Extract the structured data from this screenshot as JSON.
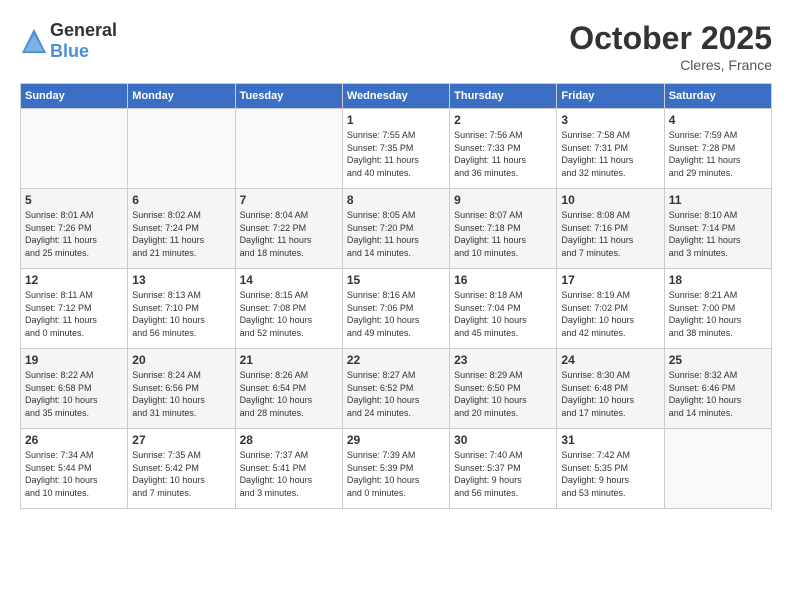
{
  "header": {
    "logo_general": "General",
    "logo_blue": "Blue",
    "month": "October 2025",
    "location": "Cleres, France"
  },
  "weekdays": [
    "Sunday",
    "Monday",
    "Tuesday",
    "Wednesday",
    "Thursday",
    "Friday",
    "Saturday"
  ],
  "weeks": [
    [
      {
        "day": "",
        "info": ""
      },
      {
        "day": "",
        "info": ""
      },
      {
        "day": "",
        "info": ""
      },
      {
        "day": "1",
        "info": "Sunrise: 7:55 AM\nSunset: 7:35 PM\nDaylight: 11 hours\nand 40 minutes."
      },
      {
        "day": "2",
        "info": "Sunrise: 7:56 AM\nSunset: 7:33 PM\nDaylight: 11 hours\nand 36 minutes."
      },
      {
        "day": "3",
        "info": "Sunrise: 7:58 AM\nSunset: 7:31 PM\nDaylight: 11 hours\nand 32 minutes."
      },
      {
        "day": "4",
        "info": "Sunrise: 7:59 AM\nSunset: 7:28 PM\nDaylight: 11 hours\nand 29 minutes."
      }
    ],
    [
      {
        "day": "5",
        "info": "Sunrise: 8:01 AM\nSunset: 7:26 PM\nDaylight: 11 hours\nand 25 minutes."
      },
      {
        "day": "6",
        "info": "Sunrise: 8:02 AM\nSunset: 7:24 PM\nDaylight: 11 hours\nand 21 minutes."
      },
      {
        "day": "7",
        "info": "Sunrise: 8:04 AM\nSunset: 7:22 PM\nDaylight: 11 hours\nand 18 minutes."
      },
      {
        "day": "8",
        "info": "Sunrise: 8:05 AM\nSunset: 7:20 PM\nDaylight: 11 hours\nand 14 minutes."
      },
      {
        "day": "9",
        "info": "Sunrise: 8:07 AM\nSunset: 7:18 PM\nDaylight: 11 hours\nand 10 minutes."
      },
      {
        "day": "10",
        "info": "Sunrise: 8:08 AM\nSunset: 7:16 PM\nDaylight: 11 hours\nand 7 minutes."
      },
      {
        "day": "11",
        "info": "Sunrise: 8:10 AM\nSunset: 7:14 PM\nDaylight: 11 hours\nand 3 minutes."
      }
    ],
    [
      {
        "day": "12",
        "info": "Sunrise: 8:11 AM\nSunset: 7:12 PM\nDaylight: 11 hours\nand 0 minutes."
      },
      {
        "day": "13",
        "info": "Sunrise: 8:13 AM\nSunset: 7:10 PM\nDaylight: 10 hours\nand 56 minutes."
      },
      {
        "day": "14",
        "info": "Sunrise: 8:15 AM\nSunset: 7:08 PM\nDaylight: 10 hours\nand 52 minutes."
      },
      {
        "day": "15",
        "info": "Sunrise: 8:16 AM\nSunset: 7:06 PM\nDaylight: 10 hours\nand 49 minutes."
      },
      {
        "day": "16",
        "info": "Sunrise: 8:18 AM\nSunset: 7:04 PM\nDaylight: 10 hours\nand 45 minutes."
      },
      {
        "day": "17",
        "info": "Sunrise: 8:19 AM\nSunset: 7:02 PM\nDaylight: 10 hours\nand 42 minutes."
      },
      {
        "day": "18",
        "info": "Sunrise: 8:21 AM\nSunset: 7:00 PM\nDaylight: 10 hours\nand 38 minutes."
      }
    ],
    [
      {
        "day": "19",
        "info": "Sunrise: 8:22 AM\nSunset: 6:58 PM\nDaylight: 10 hours\nand 35 minutes."
      },
      {
        "day": "20",
        "info": "Sunrise: 8:24 AM\nSunset: 6:56 PM\nDaylight: 10 hours\nand 31 minutes."
      },
      {
        "day": "21",
        "info": "Sunrise: 8:26 AM\nSunset: 6:54 PM\nDaylight: 10 hours\nand 28 minutes."
      },
      {
        "day": "22",
        "info": "Sunrise: 8:27 AM\nSunset: 6:52 PM\nDaylight: 10 hours\nand 24 minutes."
      },
      {
        "day": "23",
        "info": "Sunrise: 8:29 AM\nSunset: 6:50 PM\nDaylight: 10 hours\nand 20 minutes."
      },
      {
        "day": "24",
        "info": "Sunrise: 8:30 AM\nSunset: 6:48 PM\nDaylight: 10 hours\nand 17 minutes."
      },
      {
        "day": "25",
        "info": "Sunrise: 8:32 AM\nSunset: 6:46 PM\nDaylight: 10 hours\nand 14 minutes."
      }
    ],
    [
      {
        "day": "26",
        "info": "Sunrise: 7:34 AM\nSunset: 5:44 PM\nDaylight: 10 hours\nand 10 minutes."
      },
      {
        "day": "27",
        "info": "Sunrise: 7:35 AM\nSunset: 5:42 PM\nDaylight: 10 hours\nand 7 minutes."
      },
      {
        "day": "28",
        "info": "Sunrise: 7:37 AM\nSunset: 5:41 PM\nDaylight: 10 hours\nand 3 minutes."
      },
      {
        "day": "29",
        "info": "Sunrise: 7:39 AM\nSunset: 5:39 PM\nDaylight: 10 hours\nand 0 minutes."
      },
      {
        "day": "30",
        "info": "Sunrise: 7:40 AM\nSunset: 5:37 PM\nDaylight: 9 hours\nand 56 minutes."
      },
      {
        "day": "31",
        "info": "Sunrise: 7:42 AM\nSunset: 5:35 PM\nDaylight: 9 hours\nand 53 minutes."
      },
      {
        "day": "",
        "info": ""
      }
    ]
  ]
}
